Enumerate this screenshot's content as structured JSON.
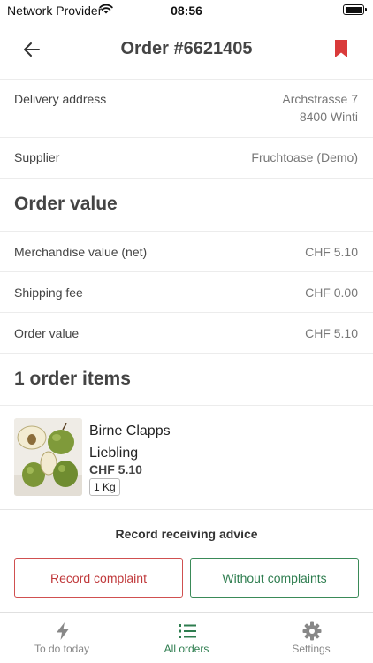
{
  "status_bar": {
    "carrier": "Network Provider",
    "time": "08:56"
  },
  "header": {
    "title": "Order #6621405",
    "back_icon": "arrow-left-icon",
    "bookmark_icon": "bookmark-icon",
    "bookmark_color": "#d93a3a"
  },
  "details": {
    "delivery_label": "Delivery address",
    "delivery_line1": "Archstrasse 7",
    "delivery_line2": "8400 Winti",
    "supplier_label": "Supplier",
    "supplier_value": "Fruchtoase (Demo)"
  },
  "order_value": {
    "title": "Order value",
    "merch_label": "Merchandise value (net)",
    "merch_value": "CHF 5.10",
    "shipping_label": "Shipping fee",
    "shipping_value": "CHF 0.00",
    "total_label": "Order value",
    "total_value": "CHF 5.10"
  },
  "items": {
    "title": "1 order items",
    "list": [
      {
        "name_line1": "Birne Clapps",
        "name_line2": "Liebling",
        "price": "CHF 5.10",
        "unit": "1 Kg",
        "image_icon": "pear-photo"
      }
    ]
  },
  "receiving": {
    "title": "Record receiving advice",
    "complaint_label": "Record complaint",
    "ok_label": "Without complaints",
    "complaint_color": "#c0393b",
    "ok_color": "#2e7d4f"
  },
  "tabbar": {
    "tabs": [
      {
        "label": "To do today",
        "icon": "bolt-icon",
        "active": false
      },
      {
        "label": "All orders",
        "icon": "list-icon",
        "active": true
      },
      {
        "label": "Settings",
        "icon": "gear-icon",
        "active": false
      }
    ],
    "active_color": "#2e7d4f"
  }
}
